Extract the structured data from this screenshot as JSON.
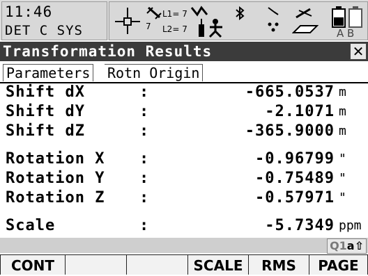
{
  "status": {
    "time": "11:46",
    "mode": "DET C SYS",
    "l1_label": "L1= 7",
    "l2_label": "L2= 7",
    "sat_count": "7",
    "battery_labels": "A B"
  },
  "window": {
    "title": "Transformation Results",
    "close_glyph": "✕"
  },
  "tabs": [
    {
      "label": "Parameters"
    },
    {
      "label": "Rotn Origin"
    }
  ],
  "rows": [
    {
      "label": "Shift dX",
      "colon": ":",
      "value": "-665.0537",
      "unit": "m"
    },
    {
      "label": "Shift dY",
      "colon": ":",
      "value": "-2.1071",
      "unit": "m"
    },
    {
      "label": "Shift dZ",
      "colon": ":",
      "value": "-365.9000",
      "unit": "m"
    },
    {
      "label": "Rotation X",
      "colon": ":",
      "value": "-0.96799",
      "unit": "\""
    },
    {
      "label": "Rotation Y",
      "colon": ":",
      "value": "-0.75489",
      "unit": "\""
    },
    {
      "label": "Rotation Z",
      "colon": ":",
      "value": "-0.57971",
      "unit": "\""
    },
    {
      "label": "Scale",
      "colon": ":",
      "value": "-5.7349",
      "unit": "ppm"
    }
  ],
  "input_indicator": {
    "q": "Q1",
    "rest": "a⇧"
  },
  "softkeys": [
    {
      "label": "CONT"
    },
    {
      "label": ""
    },
    {
      "label": ""
    },
    {
      "label": "SCALE"
    },
    {
      "label": "RMS"
    },
    {
      "label": "PAGE"
    }
  ],
  "colors": {
    "title_bg": "#3b3b3b",
    "status_bg": "#dcdcdc"
  },
  "icons": [
    "position-crosshair-icon",
    "satellite-icon",
    "antenna-icon",
    "bluetooth-icon",
    "link-icon",
    "memory-card-icon",
    "battery-icon"
  ]
}
